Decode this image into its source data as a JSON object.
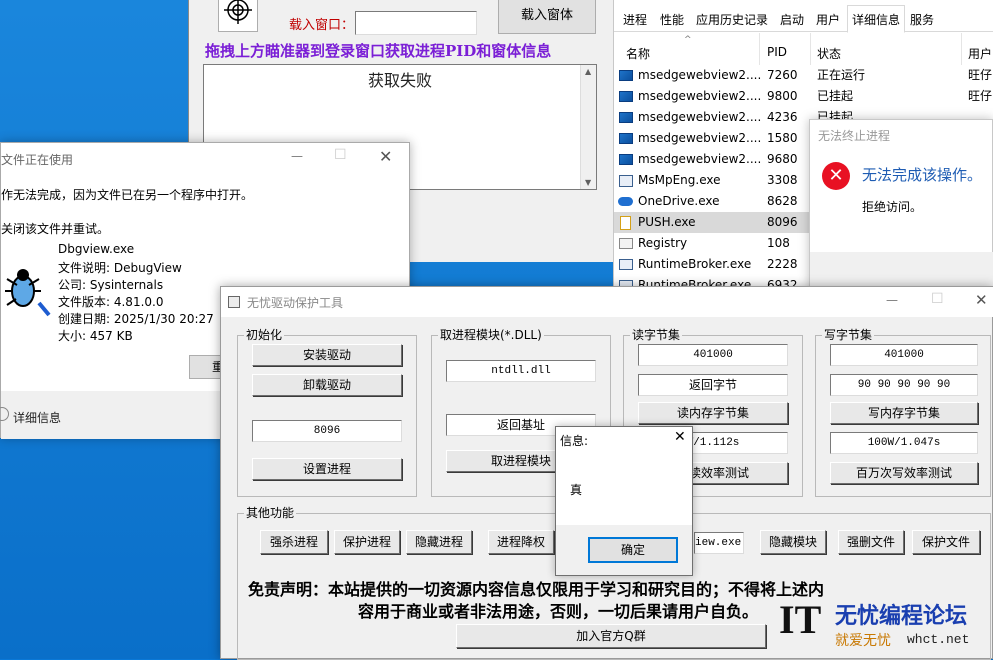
{
  "top_window": {
    "load_label": "载入窗口：",
    "load_button": "载入窗体",
    "instruction": "拖拽上方瞄准器到登录窗口获取进程PID和窗体信息",
    "result": "获取失败"
  },
  "task_manager": {
    "tabs": [
      "进程",
      "性能",
      "应用历史记录",
      "启动",
      "用户",
      "详细信息",
      "服务"
    ],
    "active_tab": "详细信息",
    "columns": [
      "名称",
      "PID",
      "状态",
      "用户"
    ],
    "rows": [
      {
        "name": "msedgewebview2....",
        "pid": "7260",
        "status": "正在运行",
        "user": "旺仔"
      },
      {
        "name": "msedgewebview2....",
        "pid": "9800",
        "status": "已挂起",
        "user": "旺仔"
      },
      {
        "name": "msedgewebview2....",
        "pid": "4236",
        "status": "已挂起",
        "user": ""
      },
      {
        "name": "msedgewebview2....",
        "pid": "1580",
        "status": "",
        "user": ""
      },
      {
        "name": "msedgewebview2....",
        "pid": "9680",
        "status": "",
        "user": ""
      },
      {
        "name": "MsMpEng.exe",
        "pid": "3308",
        "status": "",
        "user": ""
      },
      {
        "name": "OneDrive.exe",
        "pid": "8628",
        "status": "",
        "user": ""
      },
      {
        "name": "PUSH.exe",
        "pid": "8096",
        "status": "",
        "user": ""
      },
      {
        "name": "Registry",
        "pid": "108",
        "status": "",
        "user": ""
      },
      {
        "name": "RuntimeBroker.exe",
        "pid": "2228",
        "status": "",
        "user": ""
      },
      {
        "name": "RuntimeBroker.exe",
        "pid": "6932",
        "status": "",
        "user": ""
      }
    ]
  },
  "error_dialog": {
    "title": "无法终止进程",
    "message": "无法完成该操作。",
    "detail": "拒绝访问。"
  },
  "file_dialog": {
    "title": "文件正在使用",
    "line1": "作无法完成，因为文件已在另一个程序中打开。",
    "line2": "关闭该文件并重试。",
    "file_name": "Dbgview.exe",
    "description": "文件说明: DebugView",
    "company": "公司: Sysinternals",
    "version": "文件版本: 4.81.0.0",
    "created": "创建日期: 2025/1/30 20:27",
    "size": "大小: 457 KB",
    "retry_partial": "重",
    "details": "详细信息"
  },
  "main_window": {
    "title": "无忧驱动保护工具",
    "init": {
      "title": "初始化",
      "install": "安装驱动",
      "uninstall": "卸载驱动",
      "pid": "8096",
      "set_process": "设置进程"
    },
    "module": {
      "title": "取进程模块(*.DLL)",
      "dll": "ntdll.dll",
      "base": "返回基址",
      "get_module": "取进程模块"
    },
    "read": {
      "title": "读字节集",
      "addr": "401000",
      "ret": "返回字节",
      "read_btn": "读内存字节集",
      "perf": "W/1.112s",
      "test_btn": "次读效率测试"
    },
    "write": {
      "title": "写字节集",
      "addr": "401000",
      "bytes": "90 90 90 90 90",
      "write_btn": "写内存字节集",
      "perf": "100W/1.047s",
      "test_btn": "百万次写效率测试"
    },
    "other": {
      "title": "其他功能",
      "kill": "强杀进程",
      "protect": "保护进程",
      "hide": "隐藏进程",
      "lower": "进程降权",
      "module_field": "iew.exe",
      "hide_module": "隐藏模块",
      "force_delete": "强删文件",
      "protect_file": "保护文件"
    },
    "disclaimer1": "免责声明：本站提供的一切资源内容信息仅限用于学习和研究目的；不得将上述内",
    "disclaimer2": "容用于商业或者非法用途，否则，一切后果请用户自负。",
    "join_group": "加入官方Q群"
  },
  "info_dialog": {
    "title": "信息:",
    "message": "真",
    "ok": "确定"
  },
  "watermark": {
    "logo": "IT",
    "name": "无忧编程论坛",
    "slogan": "就爱无忧",
    "url": "whct.net"
  }
}
